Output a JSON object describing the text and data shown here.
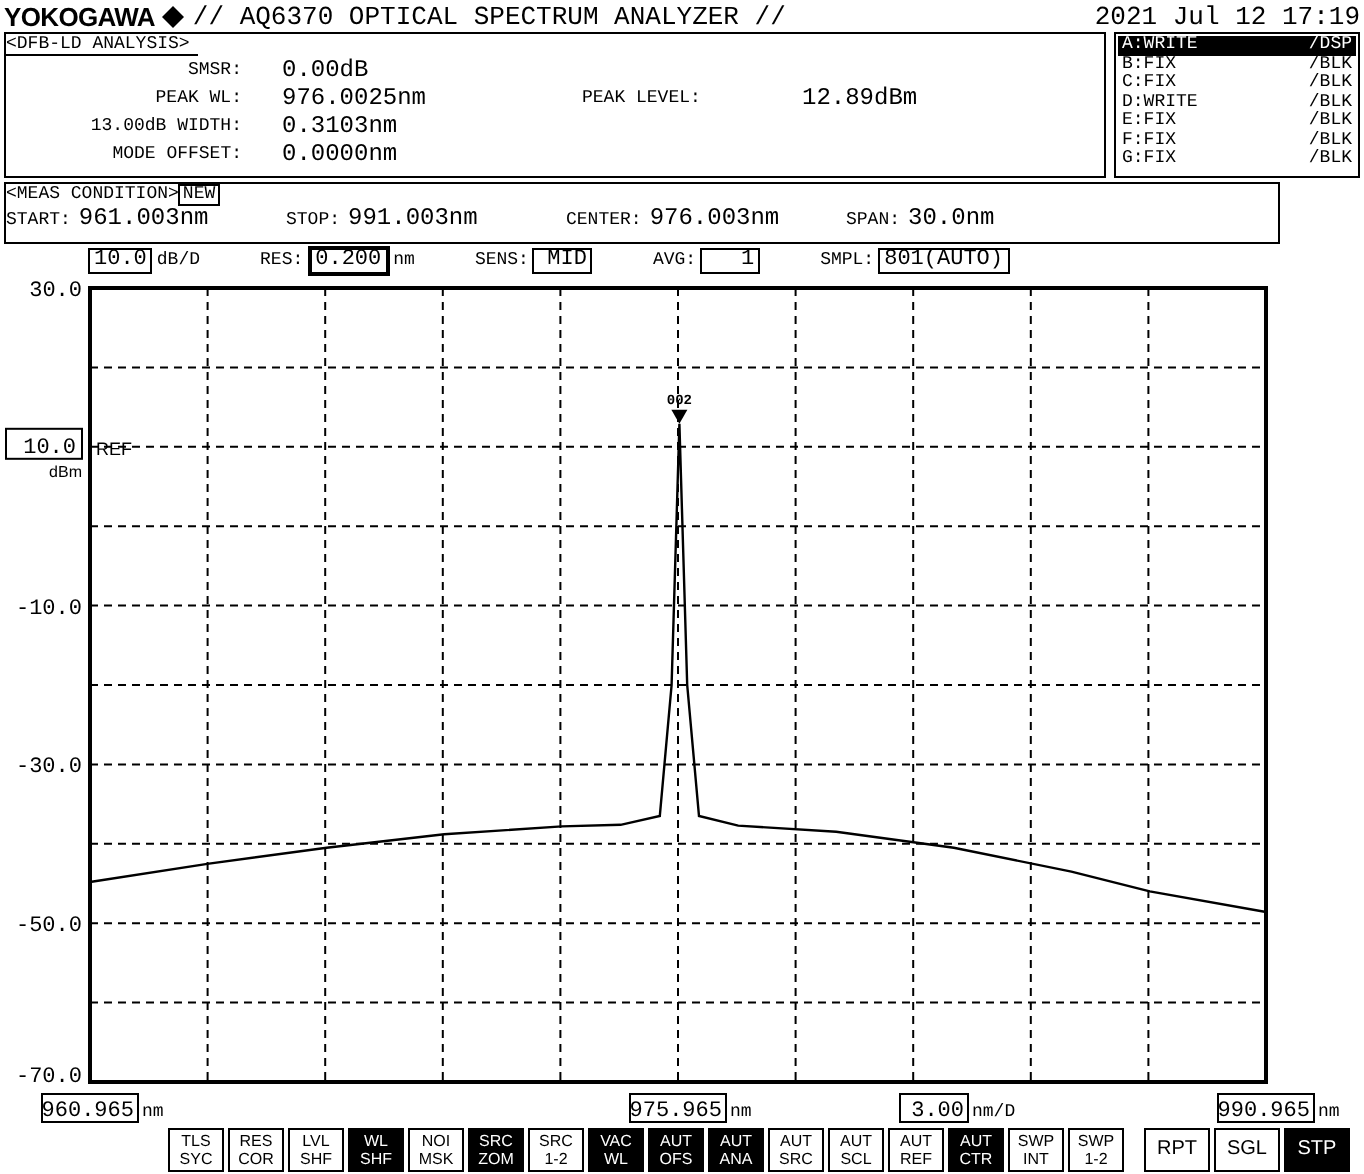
{
  "header": {
    "brand": "YOKOGAWA",
    "title": "// AQ6370 OPTICAL SPECTRUM ANALYZER //",
    "datetime": "2021 Jul 12 17:19"
  },
  "analysis": {
    "title": "<DFB-LD ANALYSIS>",
    "rows": [
      {
        "label": "SMSR:",
        "value": "0.00dB"
      },
      {
        "label": "PEAK WL:",
        "value": "976.0025nm",
        "extra": {
          "label": "PEAK LEVEL:",
          "value": "12.89dBm"
        }
      },
      {
        "label": "13.00dB WIDTH:",
        "value": "0.3103nm"
      },
      {
        "label": "MODE OFFSET:",
        "value": "0.0000nm"
      }
    ]
  },
  "traces": [
    {
      "label": "A:WRITE",
      "mode": "/DSP",
      "selected": true
    },
    {
      "label": "B:FIX",
      "mode": "/BLK",
      "selected": false
    },
    {
      "label": "C:FIX",
      "mode": "/BLK",
      "selected": false
    },
    {
      "label": "D:WRITE",
      "mode": "/BLK",
      "selected": false
    },
    {
      "label": "E:FIX",
      "mode": "/BLK",
      "selected": false
    },
    {
      "label": "F:FIX",
      "mode": "/BLK",
      "selected": false
    },
    {
      "label": "G:FIX",
      "mode": "/BLK",
      "selected": false
    }
  ],
  "meas_condition": {
    "title": "<MEAS CONDITION>",
    "badge": "NEW",
    "fields": [
      {
        "label": "START:",
        "value": "961.003nm"
      },
      {
        "label": "STOP:",
        "value": "991.003nm"
      },
      {
        "label": "CENTER:",
        "value": "976.003nm"
      },
      {
        "label": "SPAN:",
        "value": "30.0nm"
      }
    ]
  },
  "settings": [
    {
      "value": "10.0",
      "unit": "dB/D",
      "emphasized": false
    },
    {
      "label": "RES:",
      "value": "0.200",
      "unit": "nm",
      "emphasized": true
    },
    {
      "label": "SENS:",
      "value": "MID",
      "emphasized": false
    },
    {
      "label": "AVG:",
      "value": "1",
      "emphasized": false
    },
    {
      "label": "SMPL:",
      "value": "801(AUTO)",
      "emphasized": false
    }
  ],
  "ref_level": {
    "value": "10.0",
    "label": "REF",
    "unit": "dBm"
  },
  "marker": "002",
  "chart_data": {
    "type": "line",
    "xlim": [
      960.965,
      990.965
    ],
    "ylim": [
      -70,
      30
    ],
    "grid": true,
    "yticks": [
      {
        "value": 30,
        "label": "30.0"
      },
      {
        "value": -10,
        "label": "-10.0"
      },
      {
        "value": -30,
        "label": "-30.0"
      },
      {
        "value": -50,
        "label": "-50.0"
      },
      {
        "value": -70,
        "label": "-70.0"
      }
    ],
    "xticks": [
      {
        "value": 960.965,
        "label": "960.965"
      },
      {
        "value": 975.965,
        "label": "975.965"
      },
      {
        "value": 990.965,
        "label": "990.965"
      }
    ],
    "x": [
      960.965,
      964,
      967,
      970,
      973,
      974.5,
      975.5,
      975.8,
      976.0,
      976.2,
      976.5,
      977.5,
      980,
      983,
      986,
      988,
      990.965
    ],
    "series": [
      {
        "color": "#000000",
        "values": [
          -44.8,
          -42.5,
          -40.5,
          -38.8,
          -37.8,
          -37.6,
          -36.5,
          -20,
          12.9,
          -20,
          -36.5,
          -37.7,
          -38.5,
          -40.5,
          -43.5,
          -46,
          -48.6
        ]
      }
    ]
  },
  "x_tick_units": [
    "nm",
    "nm",
    "nm"
  ],
  "x_division": {
    "value": "3.00",
    "unit": "nm/D"
  },
  "keys": [
    {
      "kind": "small",
      "lines": [
        "TLS",
        "SYC"
      ],
      "active": false
    },
    {
      "kind": "small",
      "lines": [
        "RES",
        "COR"
      ],
      "active": false
    },
    {
      "kind": "small",
      "lines": [
        "LVL",
        "SHF"
      ],
      "active": false
    },
    {
      "kind": "small",
      "lines": [
        "WL",
        "SHF"
      ],
      "active": true
    },
    {
      "kind": "small",
      "lines": [
        "NOI",
        "MSK"
      ],
      "active": false
    },
    {
      "kind": "small",
      "lines": [
        "SRC",
        "ZOM"
      ],
      "active": true
    },
    {
      "kind": "small",
      "lines": [
        "SRC",
        "1-2"
      ],
      "active": false
    },
    {
      "kind": "small",
      "lines": [
        "VAC",
        "WL"
      ],
      "active": true
    },
    {
      "kind": "small",
      "lines": [
        "AUT",
        "OFS"
      ],
      "active": true
    },
    {
      "kind": "small",
      "lines": [
        "AUT",
        "ANA"
      ],
      "active": true
    },
    {
      "kind": "small",
      "lines": [
        "AUT",
        "SRC"
      ],
      "active": false
    },
    {
      "kind": "small",
      "lines": [
        "AUT",
        "SCL"
      ],
      "active": false
    },
    {
      "kind": "small",
      "lines": [
        "AUT",
        "REF"
      ],
      "active": false
    },
    {
      "kind": "small",
      "lines": [
        "AUT",
        "CTR"
      ],
      "active": true
    },
    {
      "kind": "small",
      "lines": [
        "SWP",
        "INT"
      ],
      "active": false
    },
    {
      "kind": "small",
      "lines": [
        "SWP",
        "1-2"
      ],
      "active": false
    },
    {
      "kind": "wide",
      "lines": [
        "RPT"
      ],
      "active": false
    },
    {
      "kind": "wide",
      "lines": [
        "SGL"
      ],
      "active": false
    },
    {
      "kind": "wide",
      "lines": [
        "STP"
      ],
      "active": true
    }
  ]
}
